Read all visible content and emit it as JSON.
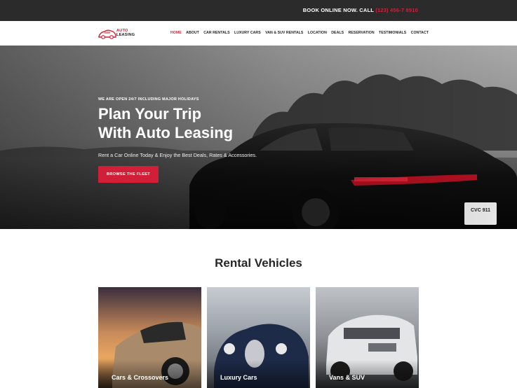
{
  "topbar": {
    "text": "BOOK ONLINE NOW. CALL",
    "phone": "(123) 456-7 8910"
  },
  "logo": {
    "line1": "AUTO",
    "line2": "LEASING",
    "icon": "car-logo-icon"
  },
  "nav": {
    "items": [
      {
        "label": "HOME",
        "active": true
      },
      {
        "label": "ABOUT",
        "active": false
      },
      {
        "label": "CAR RENTALS",
        "active": false
      },
      {
        "label": "LUXURY CARS",
        "active": false
      },
      {
        "label": "VAN & SUV RENTALS",
        "active": false
      },
      {
        "label": "LOCATION",
        "active": false
      },
      {
        "label": "DEALS",
        "active": false
      },
      {
        "label": "RESERVATION",
        "active": false
      },
      {
        "label": "TESTIMONIALS",
        "active": false
      },
      {
        "label": "CONTACT",
        "active": false
      }
    ]
  },
  "hero": {
    "tagline": "WE ARE OPEN 24/7 INCLUDING MAJOR HOLIDAYS",
    "title_line1": "Plan Your Trip",
    "title_line2": "With Auto Leasing",
    "subtitle": "Rent a Car Online Today & Enjoy the Best Deals, Rates & Accessories.",
    "button": "BROWSE THE FLEET",
    "plate": "CVC 911"
  },
  "section": {
    "title": "Rental Vehicles"
  },
  "cards": [
    {
      "label": "Cars & Crossovers"
    },
    {
      "label": "Luxury Cars"
    },
    {
      "label": "Vans & SUV"
    }
  ],
  "colors": {
    "accent": "#d11f37",
    "topbar": "#2b2b2b",
    "text_dark": "#262626"
  }
}
